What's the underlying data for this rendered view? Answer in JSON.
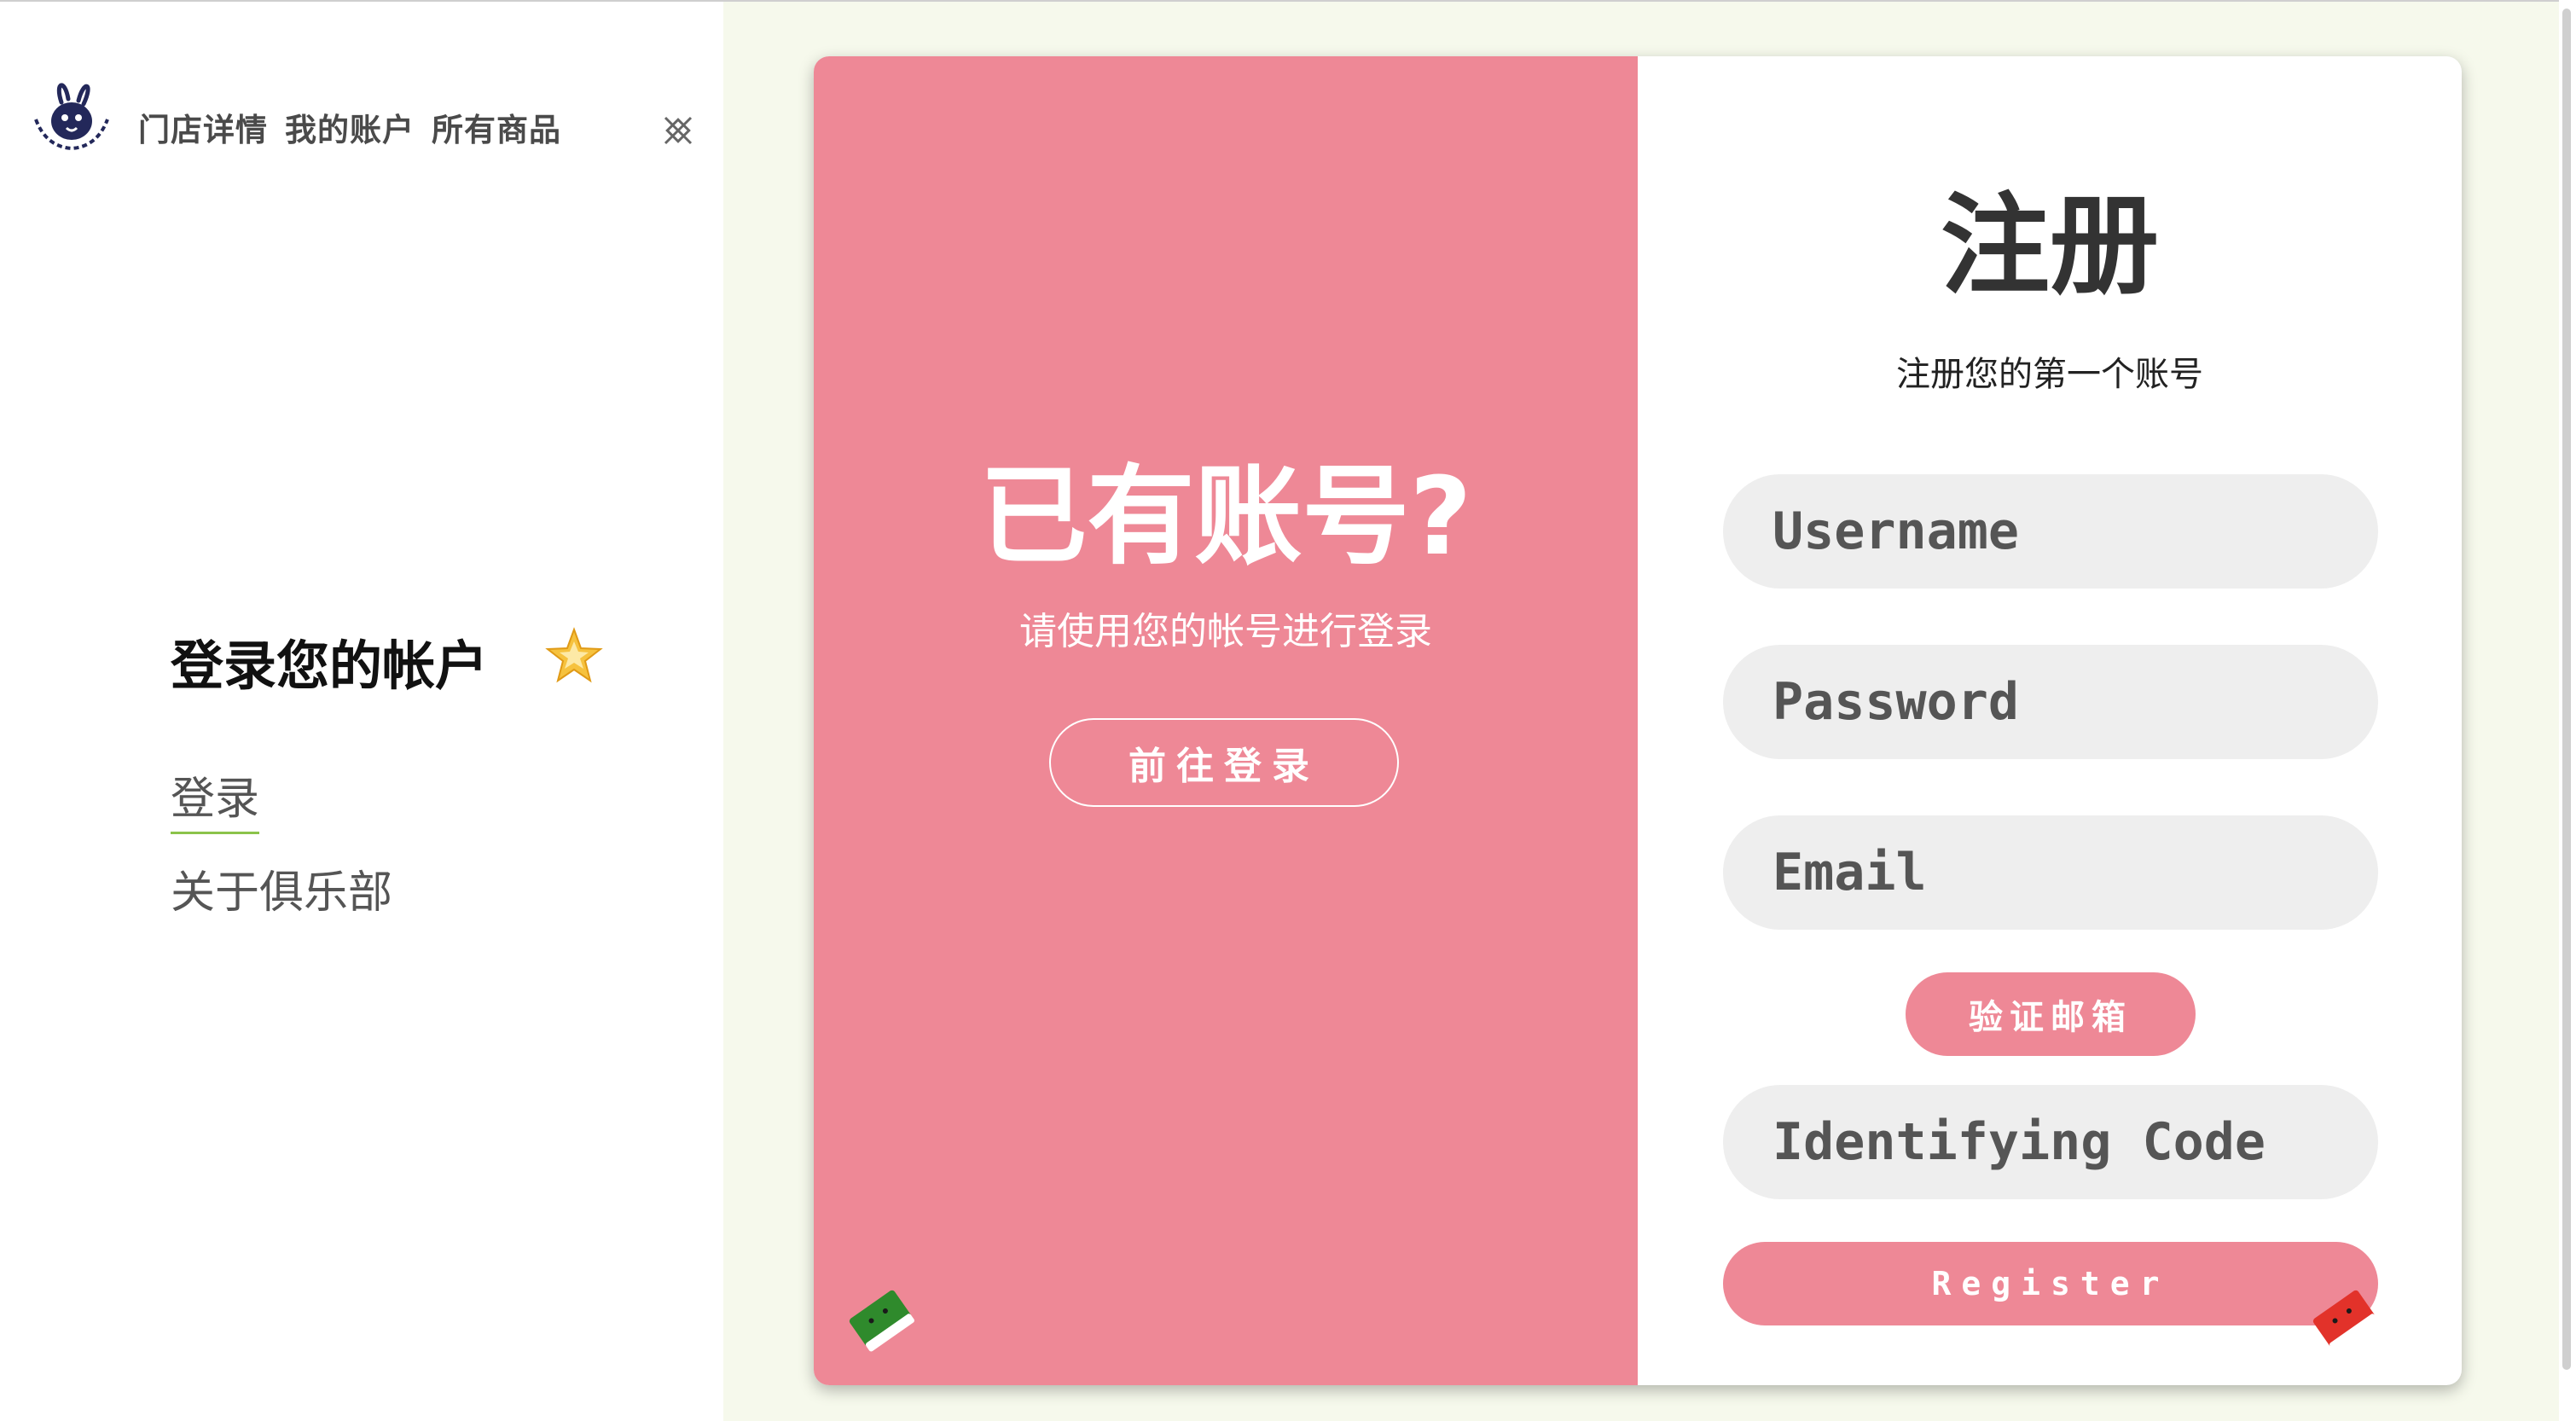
{
  "sidebar": {
    "logo_icon": "club-rabbit-logo-icon",
    "nav": [
      "门店详情",
      "我的账户",
      "所有商品"
    ],
    "close_icon": "close-x-icon",
    "heading": "登录您的帐户",
    "heading_icon": "star-icon",
    "links": {
      "login": "登录",
      "about": "关于俱乐部"
    },
    "accent_color": "#8bc34a"
  },
  "card": {
    "left": {
      "title": "已有账号?",
      "subtitle": "请使用您的帐号进行登录",
      "button": "前往登录",
      "background": "#ee8896",
      "decor_icon": "green-toy-block-icon"
    },
    "right": {
      "title": "注册",
      "subtitle": "注册您的第一个账号",
      "username_placeholder": "Username",
      "password_placeholder": "Password",
      "email_placeholder": "Email",
      "verify_button": "验证邮箱",
      "code_placeholder": "Identifying Code",
      "register_button": "Register",
      "decor_icon": "red-toy-block-icon"
    }
  }
}
